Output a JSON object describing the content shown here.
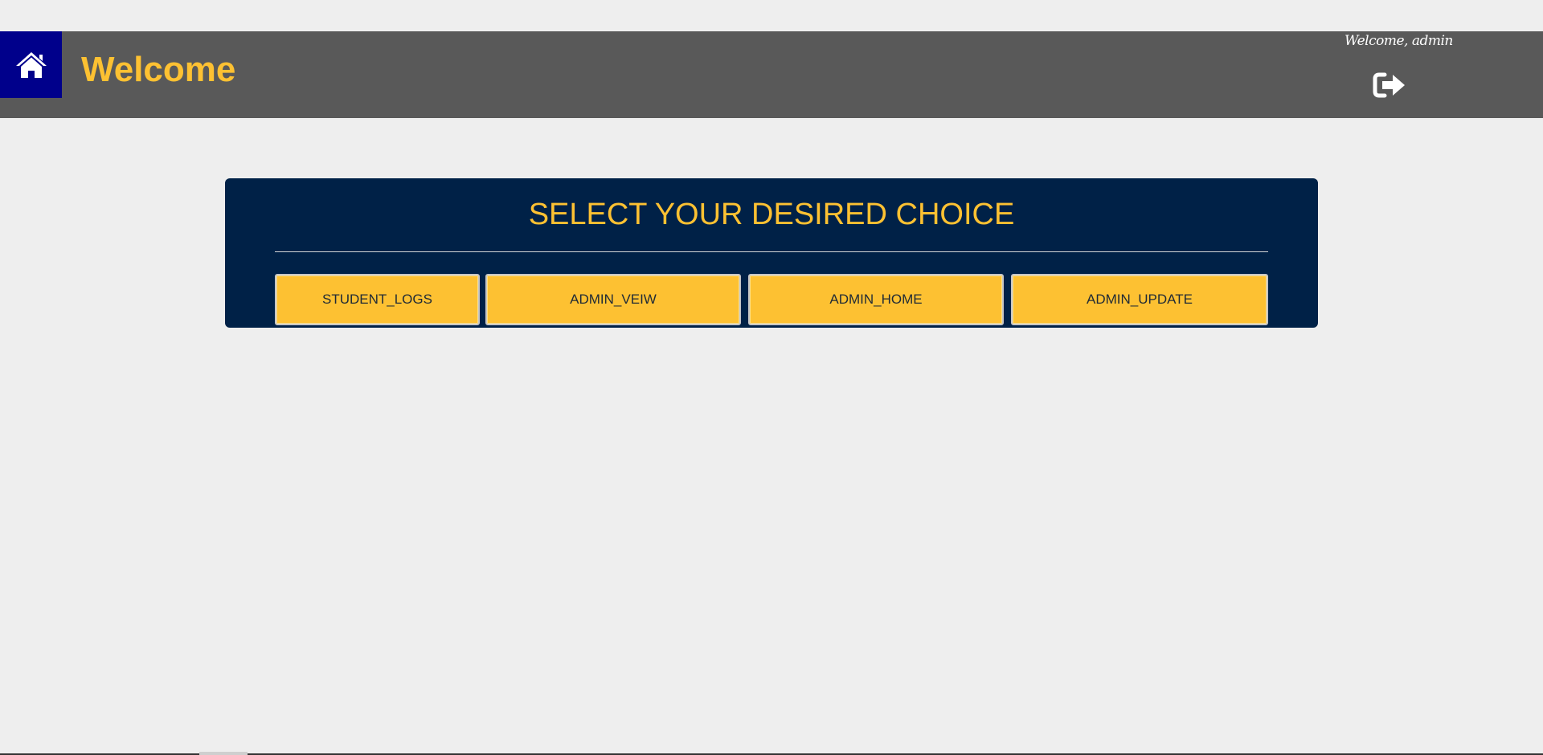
{
  "header": {
    "home_icon": "home-icon",
    "title": "Welcome",
    "welcome_user": "Welcome, admin",
    "logout_icon": "logout-icon"
  },
  "panel": {
    "heading": "SELECT YOUR DESIRED CHOICE",
    "buttons": [
      {
        "label": "STUDENT_LOGS"
      },
      {
        "label": "ADMIN_VEIW"
      },
      {
        "label": "ADMIN_HOME"
      },
      {
        "label": "ADMIN_UPDATE"
      }
    ]
  },
  "colors": {
    "header_bg": "#595959",
    "home_bg": "#00008b",
    "accent_yellow": "#fdc132",
    "panel_bg": "#002147",
    "page_bg": "#eeeeee"
  }
}
